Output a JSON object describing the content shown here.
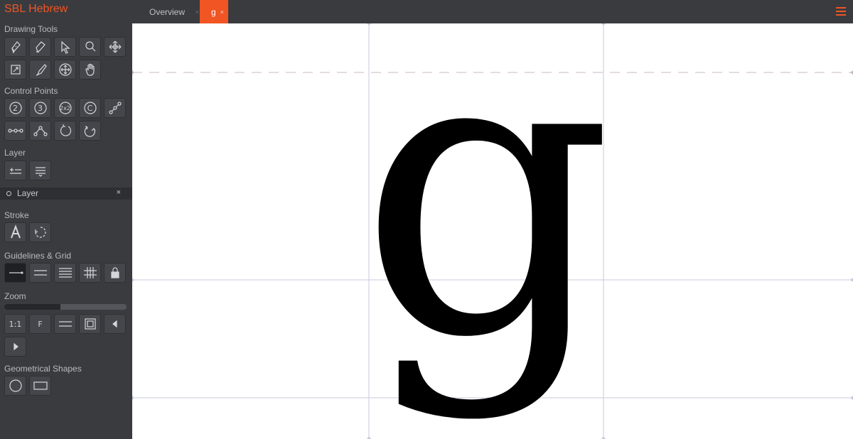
{
  "app": {
    "title": "SBL Hebrew"
  },
  "tabs": {
    "overview": "Overview",
    "glyph": "g",
    "close": "×"
  },
  "sections": {
    "drawing_tools": "Drawing Tools",
    "control_points": "Control Points",
    "layer": "Layer",
    "stroke": "Stroke",
    "guidelines": "Guidelines & Grid",
    "zoom": "Zoom",
    "shapes": "Geometrical Shapes"
  },
  "control_points": {
    "p2": "2",
    "p3": "3",
    "p2x2": "2x2",
    "pc": "C"
  },
  "layer_item": {
    "name": "Layer",
    "close": "×"
  },
  "zoom": {
    "btn_1to1": "1:1",
    "btn_fit": "F",
    "level": 0.46
  },
  "glyph": {
    "char": "g"
  },
  "colors": {
    "accent": "#f05523",
    "sidebar": "#3a3b3f",
    "guide": "#c9c8dc"
  }
}
